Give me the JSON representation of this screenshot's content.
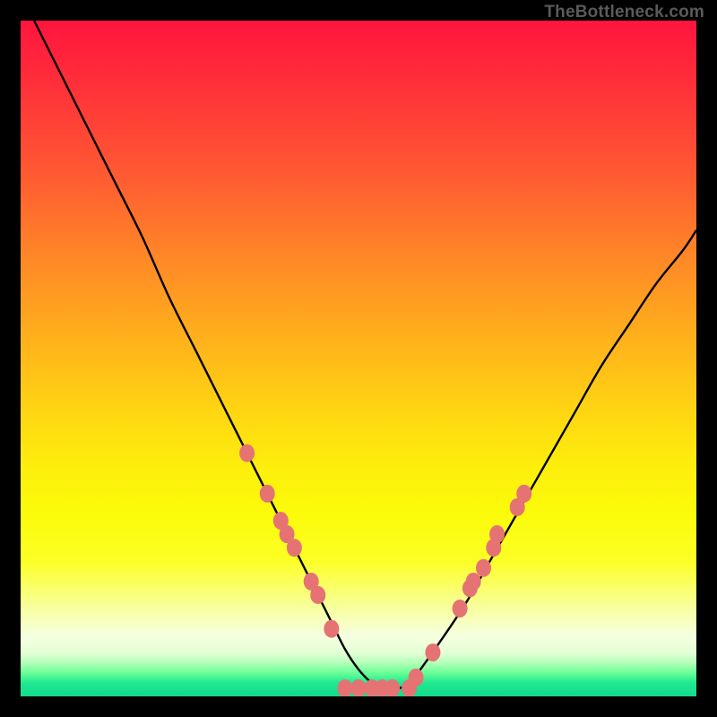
{
  "watermark": "TheBottleneck.com",
  "chart_data": {
    "type": "line",
    "title": "",
    "xlabel": "",
    "ylabel": "",
    "xlim": [
      0,
      100
    ],
    "ylim": [
      0,
      100
    ],
    "curve": {
      "x": [
        2,
        6,
        10,
        14,
        18,
        22,
        26,
        30,
        34,
        38,
        42,
        44,
        46,
        48,
        50,
        52,
        54,
        56,
        58,
        62,
        66,
        70,
        74,
        78,
        82,
        86,
        90,
        94,
        98,
        100
      ],
      "y": [
        100,
        92,
        84,
        76,
        68,
        59,
        51,
        43,
        35,
        27,
        19,
        15,
        11,
        7,
        4,
        2,
        1.2,
        1.2,
        2.5,
        8,
        14,
        21,
        28,
        35,
        42,
        49,
        55,
        61,
        66,
        69
      ]
    },
    "markers": [
      {
        "x": 33.5,
        "y": 36
      },
      {
        "x": 36.5,
        "y": 30
      },
      {
        "x": 38.5,
        "y": 26
      },
      {
        "x": 39.4,
        "y": 24
      },
      {
        "x": 40.5,
        "y": 22
      },
      {
        "x": 43,
        "y": 17
      },
      {
        "x": 44,
        "y": 15
      },
      {
        "x": 46,
        "y": 10
      },
      {
        "x": 48,
        "y": 1.2
      },
      {
        "x": 50,
        "y": 1.2
      },
      {
        "x": 52,
        "y": 1.2
      },
      {
        "x": 53.5,
        "y": 1.2
      },
      {
        "x": 55,
        "y": 1.2
      },
      {
        "x": 57.5,
        "y": 1.2
      },
      {
        "x": 58.5,
        "y": 2.8
      },
      {
        "x": 61,
        "y": 6.5
      },
      {
        "x": 65,
        "y": 13
      },
      {
        "x": 66.5,
        "y": 16
      },
      {
        "x": 67,
        "y": 17
      },
      {
        "x": 68.5,
        "y": 19
      },
      {
        "x": 70,
        "y": 22
      },
      {
        "x": 70.5,
        "y": 24
      },
      {
        "x": 73.5,
        "y": 28
      },
      {
        "x": 74.5,
        "y": 30
      }
    ],
    "background": "rainbow-vertical-gradient",
    "marker_color": "#e57373",
    "line_color": "#000000"
  }
}
